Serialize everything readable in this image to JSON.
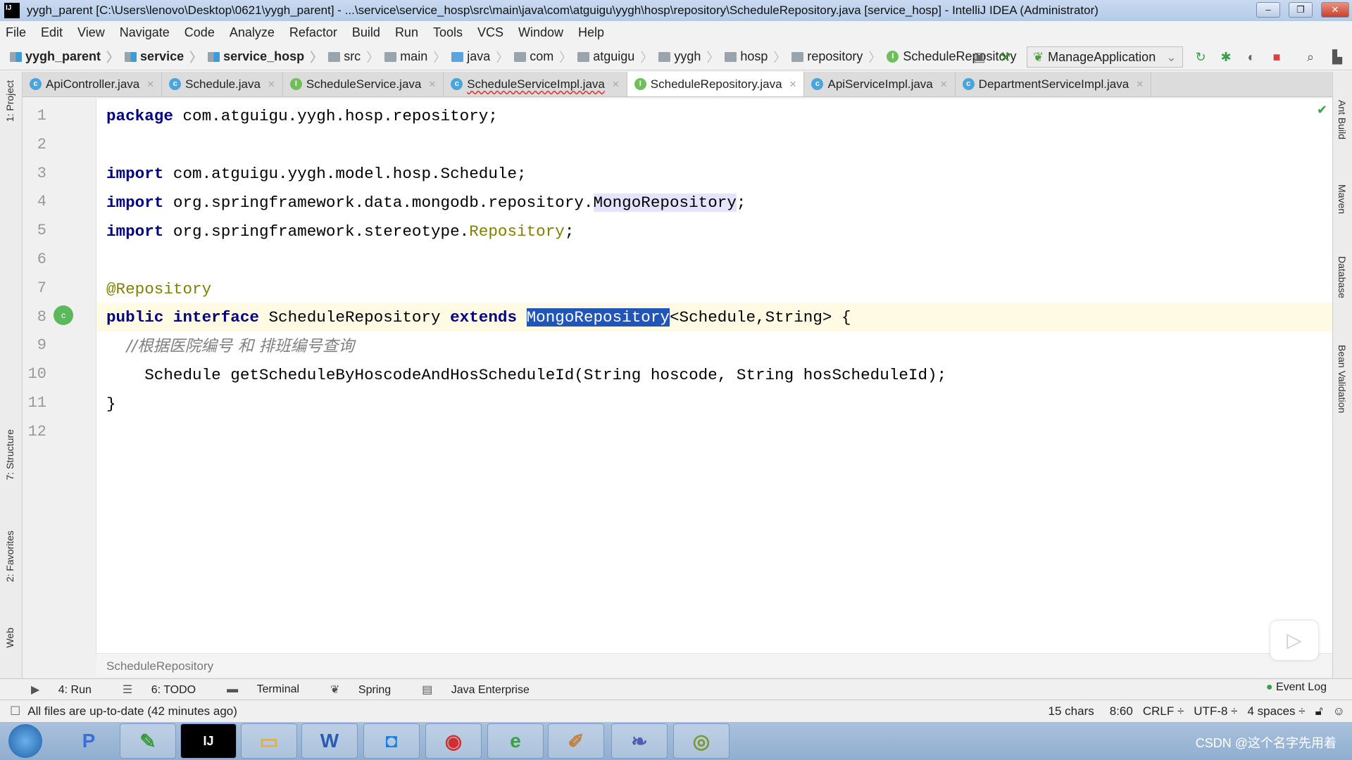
{
  "window": {
    "title": "yygh_parent [C:\\Users\\lenovo\\Desktop\\0621\\yygh_parent] - ...\\service\\service_hosp\\src\\main\\java\\com\\atguigu\\yygh\\hosp\\repository\\ScheduleRepository.java [service_hosp] - IntelliJ IDEA (Administrator)",
    "logo": "IJ"
  },
  "menu": [
    "File",
    "Edit",
    "View",
    "Navigate",
    "Code",
    "Analyze",
    "Refactor",
    "Build",
    "Run",
    "Tools",
    "VCS",
    "Window",
    "Help"
  ],
  "breadcrumb": [
    {
      "label": "yygh_parent",
      "kind": "module"
    },
    {
      "label": "service",
      "kind": "module"
    },
    {
      "label": "service_hosp",
      "kind": "module"
    },
    {
      "label": "src",
      "kind": "folder"
    },
    {
      "label": "main",
      "kind": "folder"
    },
    {
      "label": "java",
      "kind": "source"
    },
    {
      "label": "com",
      "kind": "package"
    },
    {
      "label": "atguigu",
      "kind": "package"
    },
    {
      "label": "yygh",
      "kind": "package"
    },
    {
      "label": "hosp",
      "kind": "package"
    },
    {
      "label": "repository",
      "kind": "package"
    },
    {
      "label": "ScheduleRepository",
      "kind": "interface"
    }
  ],
  "run_config": "ManageApplication",
  "tabs": [
    {
      "label": "ApiController.java",
      "type": "C"
    },
    {
      "label": "Schedule.java",
      "type": "C"
    },
    {
      "label": "ScheduleService.java",
      "type": "I"
    },
    {
      "label": "ScheduleServiceImpl.java",
      "type": "C",
      "error": true
    },
    {
      "label": "ScheduleRepository.java",
      "type": "I",
      "active": true
    },
    {
      "label": "ApiServiceImpl.java",
      "type": "C"
    },
    {
      "label": "DepartmentServiceImpl.java",
      "type": "C"
    }
  ],
  "left_tools": [
    "1: Project",
    "7: Structure",
    "2: Favorites",
    "Web"
  ],
  "right_tools": [
    "Ant Build",
    "Maven",
    "Database",
    "Bean Validation"
  ],
  "code": {
    "line_numbers": [
      "1",
      "2",
      "3",
      "4",
      "5",
      "6",
      "7",
      "8",
      "9",
      "10",
      "11",
      "12"
    ],
    "l1a": "package",
    "l1b": " com.atguigu.yygh.hosp.repository;",
    "l3a": "import",
    "l3b": " com.atguigu.yygh.model.hosp.Schedule;",
    "l4a": "import",
    "l4b": " org.springframework.data.mongodb.repository.",
    "l4c": "MongoRepository",
    "l4d": ";",
    "l5a": "import",
    "l5b": " org.springframework.stereotype.",
    "l5c": "Repository",
    "l5d": ";",
    "l7": "@Repository",
    "l8a": "public interface",
    "l8b": " ScheduleRepository ",
    "l8c": "extends",
    "l8d": " ",
    "l8e": "MongoRepository",
    "l8f": "<Schedule,String> {",
    "l9": "    //根据医院编号 和 排班编号查询",
    "l10": "    Schedule getScheduleByHoscodeAndHosScheduleId(String hoscode, String hosScheduleId);",
    "l11": "}"
  },
  "editor_breadcrumb": "ScheduleRepository",
  "tool_windows": [
    "4: Run",
    "6: TODO",
    "Terminal",
    "Spring",
    "Java Enterprise"
  ],
  "event_log": "Event Log",
  "status": {
    "message": "All files are up-to-date (42 minutes ago)",
    "chars": "15 chars",
    "position": "8:60",
    "line_sep": "CRLF ÷",
    "encoding": "UTF-8 ÷",
    "indent": "4 spaces ÷"
  },
  "watermark": "CSDN @这个名字先用着"
}
